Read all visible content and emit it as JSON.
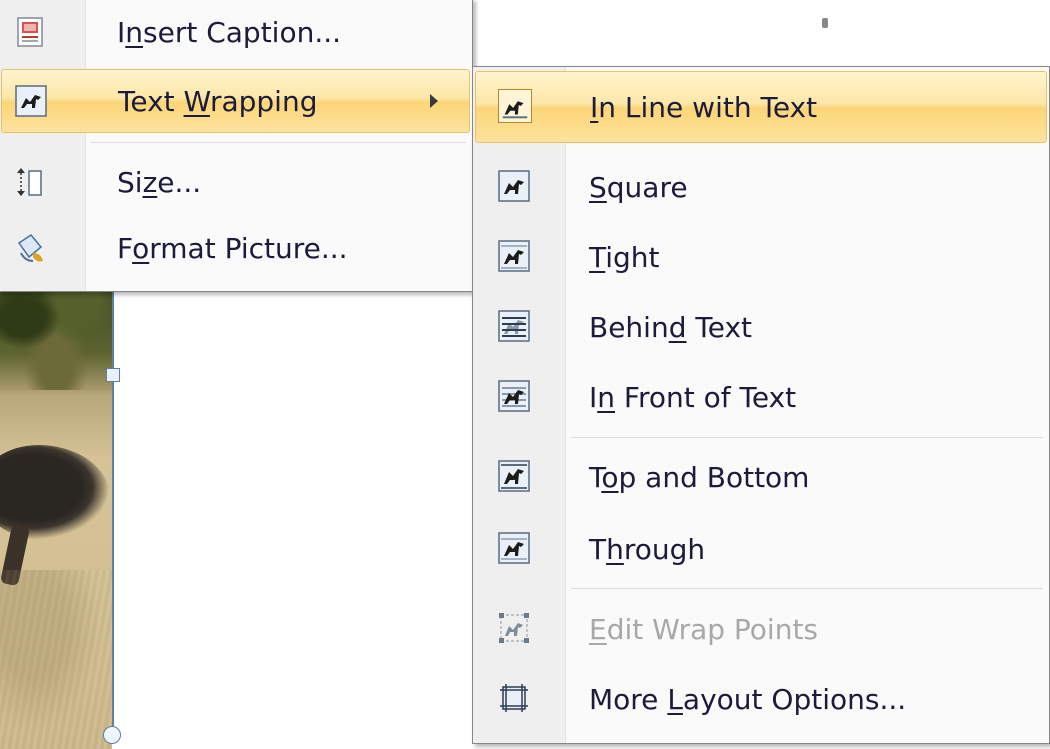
{
  "context_menu": {
    "items": [
      {
        "label_pre": "I",
        "label_u": "n",
        "label_post": "sert Caption...",
        "icon": "insert-caption-icon",
        "highlighted": false,
        "has_submenu": false
      },
      {
        "label_pre": "Text ",
        "label_u": "W",
        "label_post": "rapping",
        "icon": "text-wrapping-icon",
        "highlighted": true,
        "has_submenu": true
      },
      {
        "label_pre": "Si",
        "label_u": "z",
        "label_post": "e...",
        "icon": "size-icon",
        "highlighted": false,
        "has_submenu": false
      },
      {
        "label_pre": "F",
        "label_u": "o",
        "label_post": "rmat Picture...",
        "icon": "format-picture-icon",
        "highlighted": false,
        "has_submenu": false
      }
    ]
  },
  "text_wrapping_menu": {
    "items": [
      {
        "label_pre": "",
        "label_u": "I",
        "label_post": "n Line with Text",
        "icon": "in-line-with-text-icon",
        "highlighted": true,
        "disabled": false
      },
      {
        "label_pre": "",
        "label_u": "S",
        "label_post": "quare",
        "icon": "square-wrap-icon",
        "highlighted": false,
        "disabled": false
      },
      {
        "label_pre": "",
        "label_u": "T",
        "label_post": "ight",
        "icon": "tight-wrap-icon",
        "highlighted": false,
        "disabled": false
      },
      {
        "label_pre": "Behin",
        "label_u": "d",
        "label_post": " Text",
        "icon": "behind-text-icon",
        "highlighted": false,
        "disabled": false
      },
      {
        "label_pre": "I",
        "label_u": "n",
        "label_post": " Front of Text",
        "icon": "in-front-of-text-icon",
        "highlighted": false,
        "disabled": false
      },
      {
        "label_pre": "T",
        "label_u": "o",
        "label_post": "p and Bottom",
        "icon": "top-and-bottom-icon",
        "highlighted": false,
        "disabled": false
      },
      {
        "label_pre": "T",
        "label_u": "h",
        "label_post": "rough",
        "icon": "through-wrap-icon",
        "highlighted": false,
        "disabled": false
      },
      {
        "label_pre": "",
        "label_u": "E",
        "label_post": "dit Wrap Points",
        "icon": "edit-wrap-points-icon",
        "highlighted": false,
        "disabled": true
      },
      {
        "label_pre": "More ",
        "label_u": "L",
        "label_post": "ayout Options...",
        "icon": "more-layout-options-icon",
        "highlighted": false,
        "disabled": false
      }
    ]
  },
  "colors": {
    "highlight_top": "#fff4cd",
    "highlight_mid": "#fbd577",
    "menu_text": "#1b1b3b",
    "disabled_text": "#a8a8a8",
    "selection_frame": "#5b7fa6"
  }
}
